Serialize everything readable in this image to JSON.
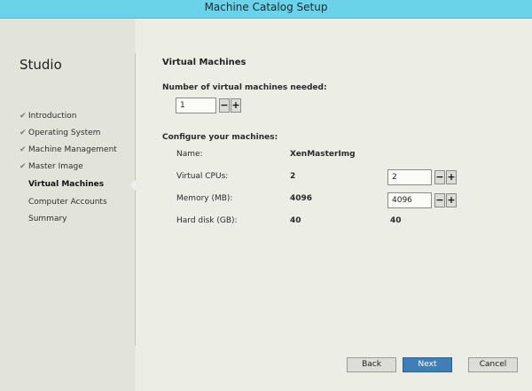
{
  "window": {
    "title": "Machine Catalog Setup"
  },
  "sidebar": {
    "title": "Studio",
    "items": [
      {
        "label": "Introduction",
        "done": true
      },
      {
        "label": "Operating System",
        "done": true
      },
      {
        "label": "Machine Management",
        "done": true
      },
      {
        "label": "Master Image",
        "done": true
      },
      {
        "label": "Virtual Machines",
        "done": false,
        "active": true
      },
      {
        "label": "Computer Accounts",
        "done": false
      },
      {
        "label": "Summary",
        "done": false
      }
    ],
    "check_glyph": "✔"
  },
  "main": {
    "page_title": "Virtual Machines",
    "vm_count_label": "Number of virtual machines needed:",
    "vm_count_value": "1",
    "configure_label": "Configure your machines:",
    "rows": {
      "name": {
        "label": "Name:",
        "value": "XenMasterImg"
      },
      "cpus": {
        "label": "Virtual CPUs:",
        "value": "2",
        "input_value": "2"
      },
      "memory": {
        "label": "Memory (MB):",
        "value": "4096",
        "input_value": "4096"
      },
      "disk": {
        "label": "Hard disk (GB):",
        "value": "40",
        "value2": "40"
      }
    },
    "stepper": {
      "minus": "−",
      "plus": "+"
    }
  },
  "footer": {
    "back_label": "Back",
    "next_label": "Next",
    "cancel_label": "Cancel"
  }
}
